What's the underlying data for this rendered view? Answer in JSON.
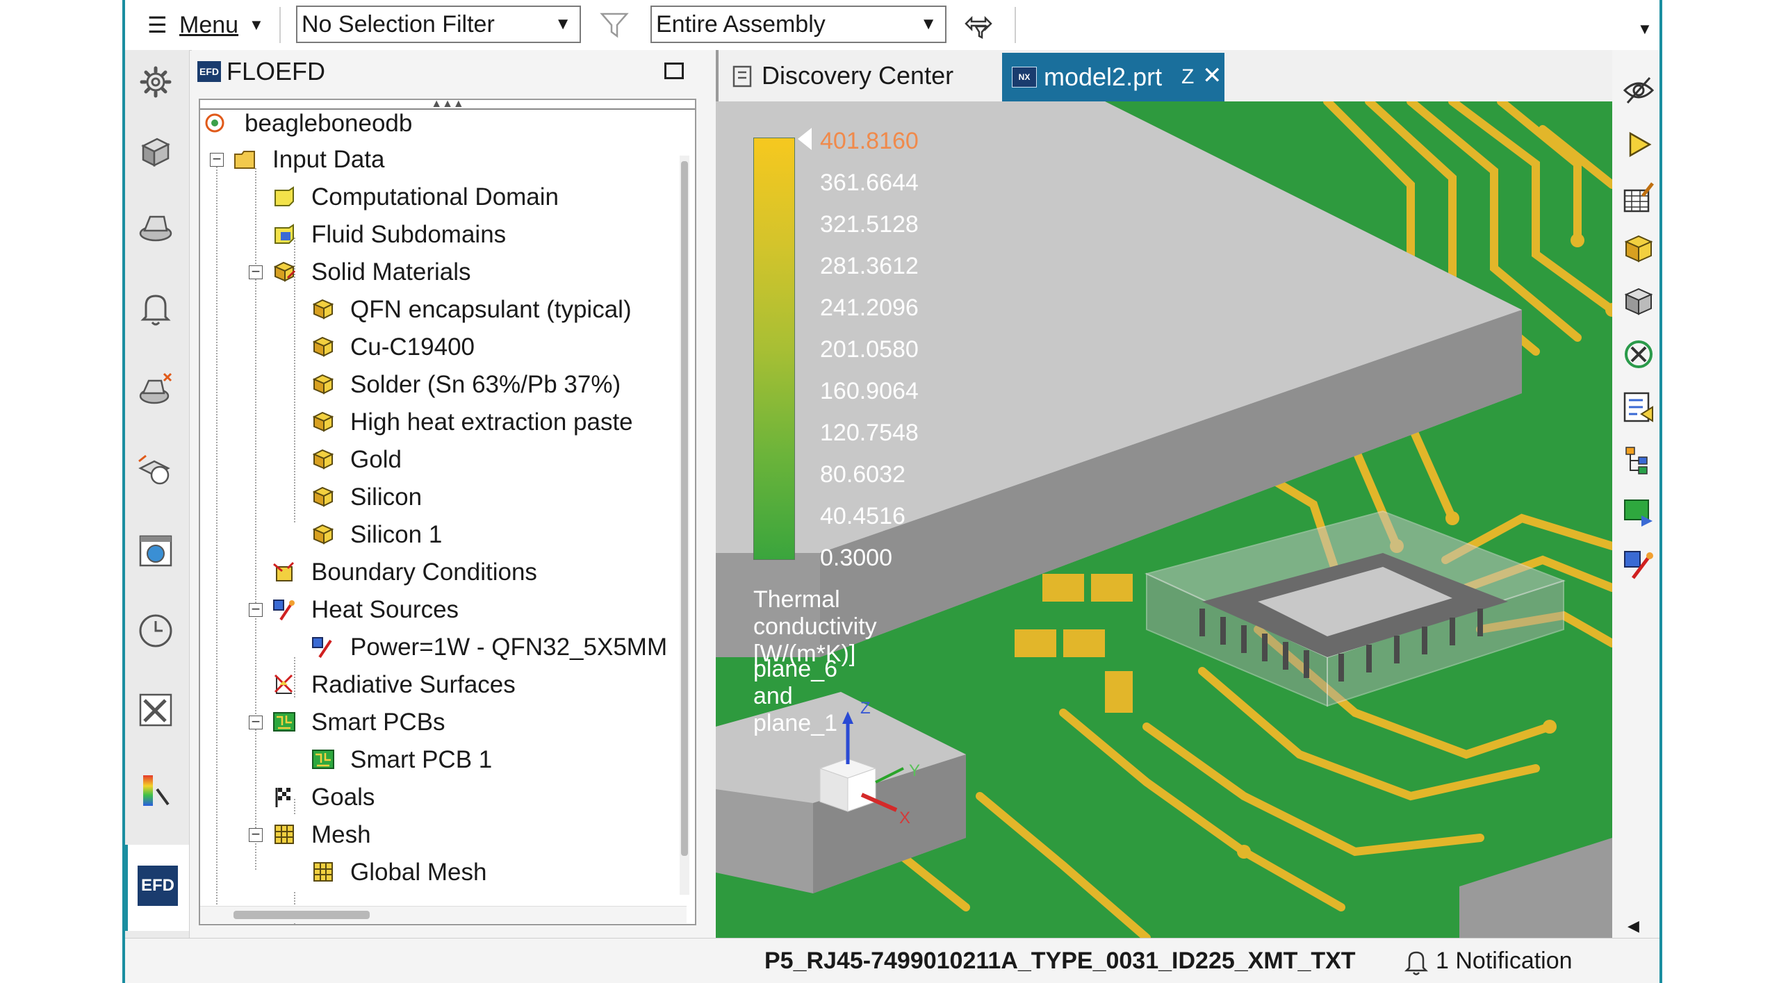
{
  "toolbar": {
    "menu_label": "Menu",
    "selection_filter": "No Selection Filter",
    "assembly_scope": "Entire Assembly"
  },
  "panel": {
    "title": "FLOEFD",
    "logo_text": "EFD"
  },
  "tree": {
    "root": "beagleboneodb",
    "input_data": "Input Data",
    "computational_domain": "Computational Domain",
    "fluid_subdomains": "Fluid Subdomains",
    "solid_materials": "Solid Materials",
    "materials": [
      "QFN encapsulant (typical)",
      "Cu-C19400",
      "Solder (Sn 63%/Pb 37%)",
      "High heat extraction paste",
      "Gold",
      "Silicon",
      "Silicon 1"
    ],
    "boundary_conditions": "Boundary Conditions",
    "heat_sources": "Heat Sources",
    "heat_source_item": "Power=1W - QFN32_5X5MM",
    "radiative_surfaces": "Radiative Surfaces",
    "smart_pcbs": "Smart PCBs",
    "smart_pcb_item": "Smart PCB 1",
    "goals": "Goals",
    "mesh": "Mesh",
    "global_mesh": "Global Mesh"
  },
  "tabs": [
    {
      "label": "Discovery Center"
    },
    {
      "label": "model2.prt",
      "suffix": "Z"
    }
  ],
  "legend": {
    "values": [
      "401.8160",
      "361.6644",
      "321.5128",
      "281.3612",
      "241.2096",
      "201.0580",
      "160.9064",
      "120.7548",
      "80.6032",
      "40.4516",
      "0.3000"
    ],
    "title": "Thermal conductivity [W/(m*K)]",
    "planes": "plane_6 and plane_1",
    "top_color": "#f08a4b"
  },
  "triad": {
    "z": "Z",
    "y": "Y",
    "x": "X"
  },
  "status": {
    "file": "P5_RJ45-7499010211A_TYPE_0031_ID225_XMT_TXT",
    "notification": "1 Notification"
  },
  "colors": {
    "accent": "#1a8ea0",
    "pcb_green": "#2e9a3e",
    "trace_gold": "#e2b62a",
    "active_tab": "#1a6f9c"
  }
}
